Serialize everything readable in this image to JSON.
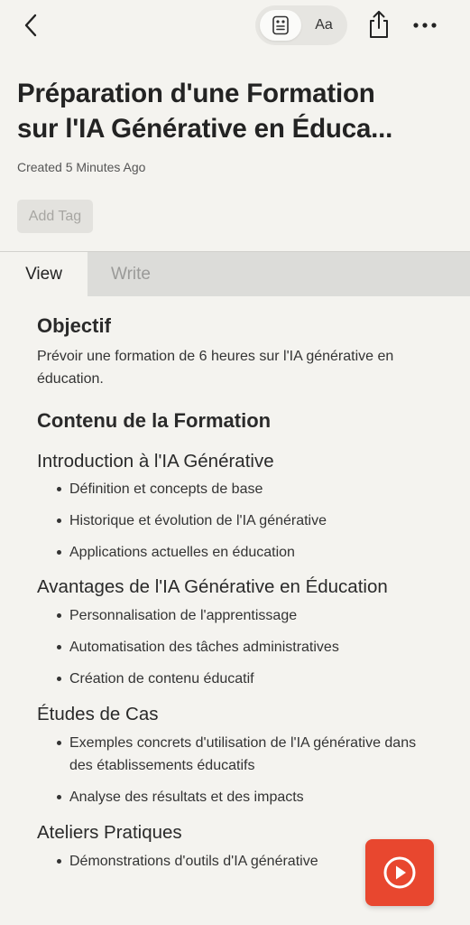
{
  "toolbar": {
    "font_label": "Aa"
  },
  "note": {
    "title_line1": "Préparation d'une Formation",
    "title_line2": "sur l'IA Générative en Éduca...",
    "created": "Created 5 Minutes Ago",
    "add_tag": "Add Tag"
  },
  "tabs": {
    "view": "View",
    "write": "Write"
  },
  "content": {
    "objectif_heading": "Objectif",
    "objectif_text": "Prévoir une formation de 6 heures sur l'IA générative en éducation.",
    "contenu_heading": "Contenu de la Formation",
    "sections": [
      {
        "heading": "Introduction à l'IA Générative",
        "items": [
          "Définition et concepts de base",
          "Historique et évolution de l'IA générative",
          "Applications actuelles en éducation"
        ]
      },
      {
        "heading": "Avantages de l'IA Générative en Éducation",
        "items": [
          "Personnalisation de l'apprentissage",
          "Automatisation des tâches administratives",
          "Création de contenu éducatif"
        ]
      },
      {
        "heading": "Études de Cas",
        "items": [
          "Exemples concrets d'utilisation de l'IA générative dans des établissements éducatifs",
          "Analyse des résultats et des impacts"
        ]
      },
      {
        "heading": "Ateliers Pratiques",
        "items": [
          "Démonstrations d'outils d'IA générative"
        ]
      }
    ]
  },
  "icons": {
    "back": "chevron-left-icon",
    "reader": "reader-mode-icon",
    "share": "share-icon",
    "more": "more-horizontal-icon",
    "play": "play-circle-icon"
  },
  "colors": {
    "accent": "#e8472f",
    "background": "#f4f3ef",
    "write_tab": "#dcdcd9"
  }
}
